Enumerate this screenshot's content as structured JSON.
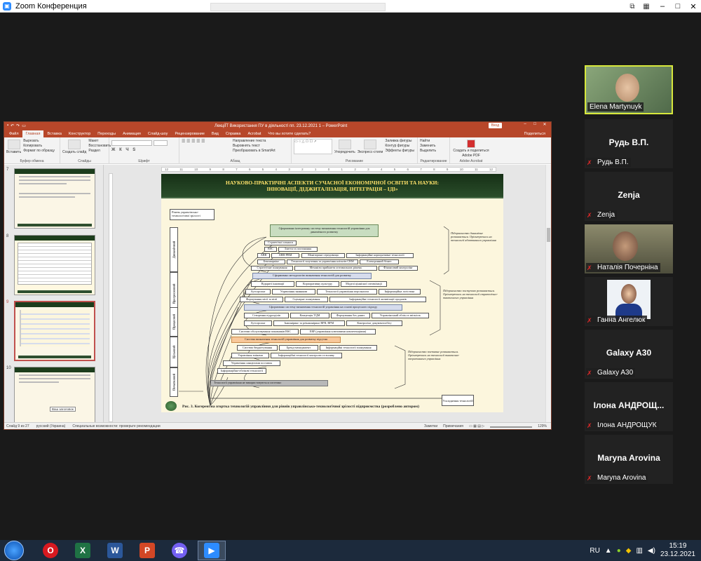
{
  "zoom": {
    "title": "Zoom Конференция"
  },
  "powerpoint": {
    "doc_title": "ЛекціЇТ Використання ПУ в діяльності пп. 23.12.2021 1 – PowerPoint",
    "signin": "Вход",
    "share": "Поделиться",
    "tabs": [
      "Файл",
      "Главная",
      "Вставка",
      "Конструктор",
      "Переходы",
      "Анимация",
      "Слайд-шоу",
      "Рецензирование",
      "Вид",
      "Справка",
      "Acrobat",
      "Что вы хотите сделать?"
    ],
    "ribbon": {
      "paste": "Вставить",
      "cut": "Вырезать",
      "copy": "Копировать",
      "format_painter": "Формат по образцу",
      "clipboard": "Буфер обмена",
      "new_slide": "Создать слайд",
      "layout": "Макет",
      "reset": "Восстановить",
      "section": "Раздел",
      "slides": "Слайды",
      "font": "Шрифт",
      "paragraph": "Абзац",
      "text_dir": "Направление текста",
      "align_text": "Выровнять текст",
      "smartart": "Преобразовать в SmartArt",
      "arrange": "Упорядочить",
      "quick_styles": "Экспресс-стили",
      "shape_fill": "Заливка фигуры",
      "shape_outline": "Контур фигуры",
      "shape_effects": "Эффекты фигуры",
      "drawing": "Рисование",
      "find": "Найти",
      "replace": "Заменить",
      "select": "Выделить",
      "editing": "Редактирование",
      "create_pdf": "Создать и поделиться Adobe PDF",
      "acrobat": "Adobe Acrobat"
    },
    "ruler_ticks": [
      "12",
      "11",
      "10",
      "9",
      "8",
      "7",
      "6",
      "5",
      "4",
      "3",
      "2",
      "1",
      "0",
      "1",
      "2",
      "3",
      "4",
      "5",
      "6",
      "7",
      "8",
      "9",
      "10",
      "11",
      "12"
    ],
    "thumbs": [
      {
        "num": "7"
      },
      {
        "num": "8"
      },
      {
        "num": "9"
      },
      {
        "num": "10",
        "note": "Ваш заголовок"
      }
    ],
    "statusbar": {
      "slide": "Слайд 9 из 27",
      "lang": "русский (Украина)",
      "access": "Специальные возможности: проверьте рекомендации",
      "notes": "Заметки",
      "comments": "Примечания",
      "zoom": "129%"
    },
    "slide": {
      "title1": "НАУКОВО-ПРАКТИЧНІ АСПЕКТИ СУЧАСНОЇ ЕКОНОМІЧНОЇ ОСВІТИ ТА НАУКИ:",
      "title2": "ІННОВАЦІЇ, ДІДЖИТАЛІЗАЦІЯ, ІНТЕГРАЦІЯ – ІДІ»",
      "corner_label": "Рівень управлінсько-технологічної зрілості",
      "levels": [
        "Динамічний",
        "Прогресивний",
        "Процесний",
        "Цільовий",
        "Початковий"
      ],
      "boxes": {
        "dyn_head": "Сформовано інтегровану систему визначення технологій управління для динамічного розвитку",
        "b1": "Стратегічні альянси",
        "b2": "BSC",
        "b3": "Злиття та поглинання",
        "b4": "ABB",
        "b5": "ABB-PBM",
        "b6": "Моніторинг середовища",
        "b7": "Інформаційне корпоративне технології",
        "b8": "Бенчмаркінг",
        "b9": "Технології залучення та управління клієнтів CRM",
        "b10": "Електронний бізнес",
        "b11": "Стратегічне планування",
        "b12": "Механізм прийняття оптимальних рішень",
        "b13": "Фінансовий контролінг",
        "prog_head": "Сформовано методологію визначення технологій для розвитку",
        "b14": "Відкриті інновації",
        "b15": "Корпоративну культуру",
        "b16": "Моделі ціннісної оптимізації",
        "b17": "Аутсорсинг",
        "b18": "Управління знаннями",
        "b19": "Технології управління персоналом",
        "b20": "Інформаційна логістика",
        "b21": "Формування місії та візії",
        "b22": "Сценарне планування",
        "b23": "Інформаційне технології активізації продажів",
        "proc_head": "Сформовано систему визначення технологій управління на основі процесного підходу",
        "b24": "Створення підрозділів",
        "b25": "Концепція TQM",
        "b26": "Формування баз даних",
        "b27": "Управлінський облік та звітність",
        "b28": "Аутсорсинг",
        "b29": "Інжиніринг та реінжиніринг BPR, BPM",
        "b30": "Контролінг документообігу",
        "b31": "Системи обслуговування показників BSC",
        "b32": "ERP (управління ключовими компетенціями)",
        "cil_head": "Система визначення технологій управління для розвитку відсутня",
        "b33": "Система бюджетування",
        "b34": "Бренд-менеджмент",
        "b35": "Інформаційні технології планування",
        "b36": "Управління змінами",
        "b37": "Інформаційні технології контролю та впливу",
        "b38": "Управління ланцюгами поставок",
        "b39": "Інформаційно-облікові технології",
        "poch_head": "Технології управління не використовуються системно"
      },
      "notes": {
        "n1": "Підприємство динамічне розвивається. Орієнтуючись на технології адаптивного управління",
        "n2": "Підприємство поступово розвивається. Орієнтуючись на технології стратегічно-тактичного управління",
        "n3": "Підприємство поетапне розвивається. Орієнтуючись на технології тактично-оперативного управління"
      },
      "axis_label": "Ускладнення технологій",
      "caption": "Рис. 3. Когерентна згортка технологій управління для рівнів управлінсько-технологічної зрілості підприємства (розроблено автором)"
    }
  },
  "participants": [
    {
      "name": "",
      "label": "Elena Martynuyk",
      "video": true
    },
    {
      "name": "Рудь В.П.",
      "label": "Рудь В.П."
    },
    {
      "name": "Zenja",
      "label": "Zenja"
    },
    {
      "name": "",
      "label": "Наталія Почерніна",
      "video": true
    },
    {
      "name": "",
      "label": "Ганна Ангелюк",
      "video": true
    },
    {
      "name": "Galaxy A30",
      "label": "Galaxy A30"
    },
    {
      "name": "Ілона АНДРОЩ...",
      "label": "Ілона АНДРОЩУК"
    },
    {
      "name": "Maryna Arovina",
      "label": "Maryna Arovina"
    }
  ],
  "taskbar": {
    "lang": "RU",
    "time": "15:19",
    "date": "23.12.2021",
    "apps": [
      "opera-icon",
      "excel-icon",
      "word-icon",
      "powerpoint-icon",
      "viber-icon",
      "zoom-icon"
    ]
  },
  "colors": {
    "ppt_red": "#b7472a",
    "slide_header_green": "#1c3d1c",
    "slide_title_yellow": "#ffe26a",
    "taskbar": "#1c2a3c"
  }
}
